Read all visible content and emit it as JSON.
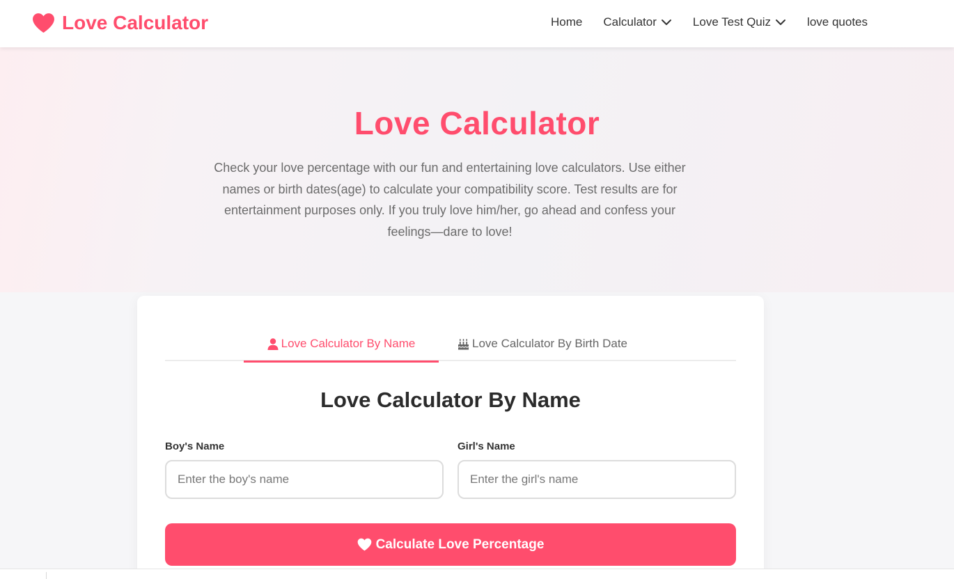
{
  "header": {
    "brand": "Love Calculator",
    "brand_icon": "heart-icon",
    "nav": [
      {
        "label": "Home",
        "dropdown": false
      },
      {
        "label": "Calculator",
        "dropdown": true
      },
      {
        "label": "Love Test Quiz",
        "dropdown": true
      },
      {
        "label": "love quotes",
        "dropdown": false
      }
    ]
  },
  "hero": {
    "title": "Love Calculator",
    "description": "Check your love percentage with our fun and entertaining love calculators. Use either names or birth dates(age) to calculate your compatibility score. Test results are for entertainment purposes only. If you truly love him/her, go ahead and confess your feelings—dare to love!"
  },
  "tabs": [
    {
      "label": "Love Calculator By Name",
      "icon": "user-icon",
      "active": true
    },
    {
      "label": "Love Calculator By Birth Date",
      "icon": "birthday-cake-icon",
      "active": false
    }
  ],
  "form": {
    "title": "Love Calculator By Name",
    "boy": {
      "label": "Boy's Name",
      "placeholder": "Enter the boy's name",
      "value": ""
    },
    "girl": {
      "label": "Girl's Name",
      "placeholder": "Enter the girl's name",
      "value": ""
    },
    "submit_label": "Calculate Love Percentage",
    "submit_icon": "heart-icon"
  },
  "colors": {
    "accent": "#ff4d6d",
    "text": "#333333",
    "muted": "#6b6b6b"
  }
}
